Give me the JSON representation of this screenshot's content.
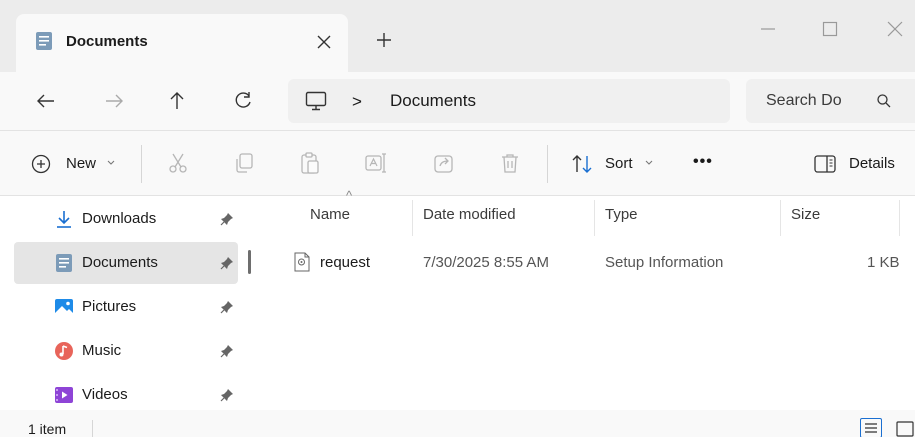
{
  "window": {
    "tab_title": "Documents",
    "tab_icon": "documents-folder-icon",
    "controls": [
      "minimize-icon",
      "maximize-icon",
      "close-icon"
    ]
  },
  "nav": {
    "breadcrumb_separator": ">",
    "breadcrumb": [
      "Documents"
    ],
    "search_placeholder": "Search Do",
    "buttons": [
      "back-icon",
      "forward-icon",
      "up-icon",
      "refresh-icon"
    ]
  },
  "toolbar": {
    "new_label": "New",
    "sort_label": "Sort",
    "more_label": "•••",
    "details_label": "Details",
    "icons": [
      "cut-icon",
      "copy-icon",
      "paste-icon",
      "rename-icon",
      "share-icon",
      "delete-icon"
    ]
  },
  "sidebar": {
    "items": [
      {
        "label": "Downloads",
        "icon": "download-icon",
        "color": "#1a6fd1"
      },
      {
        "label": "Documents",
        "icon": "documents-folder-icon",
        "color": "#6d8ba8"
      },
      {
        "label": "Pictures",
        "icon": "pictures-icon",
        "color": "#1e8be8"
      },
      {
        "label": "Music",
        "icon": "music-icon",
        "color": "#e8645a"
      },
      {
        "label": "Videos",
        "icon": "videos-icon",
        "color": "#8e44d6"
      }
    ],
    "selected_index": 1
  },
  "list": {
    "columns": [
      "Name",
      "Date modified",
      "Type",
      "Size"
    ],
    "sort_indicator": "^",
    "rows": [
      {
        "name": "request",
        "date_modified": "7/30/2025 8:55 AM",
        "type": "Setup Information",
        "size": "1 KB",
        "icon": "setup-file-icon"
      }
    ]
  },
  "status": {
    "item_count": "1 item",
    "view_buttons": [
      "details-view-icon",
      "large-icons-view-icon"
    ]
  }
}
